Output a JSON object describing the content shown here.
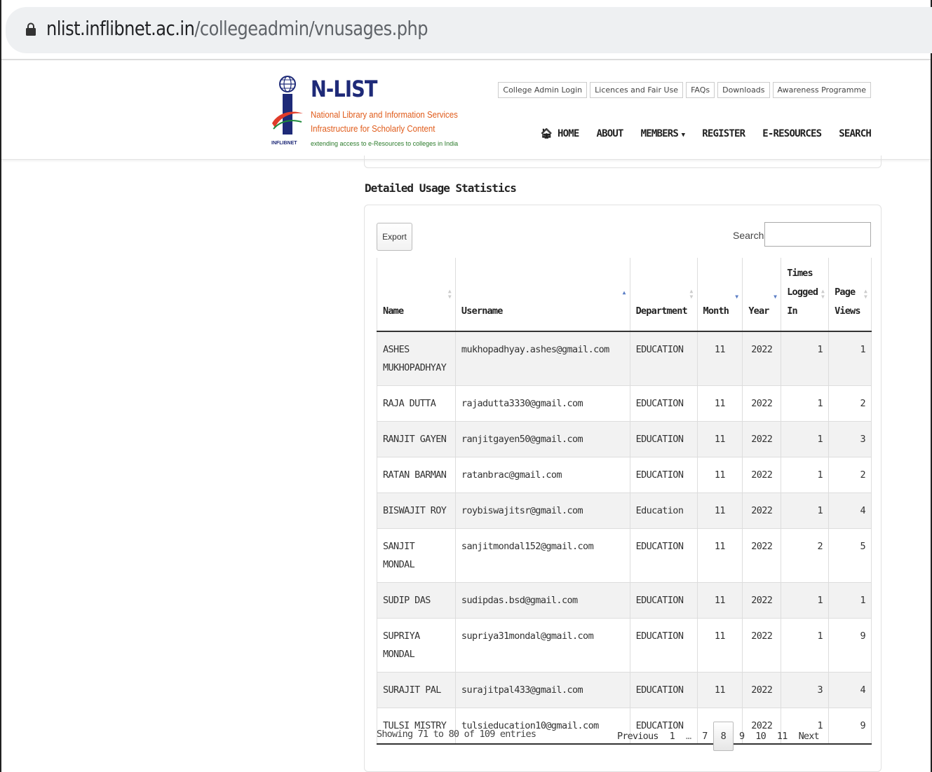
{
  "browser": {
    "url_host": "nlist.inflibnet.ac.in",
    "url_path": "/collegeadmin/vnusages.php"
  },
  "logo": {
    "title": "N-LIST",
    "subtitle1": "National Library and Information Services",
    "subtitle2": "Infrastructure for Scholarly Content",
    "tagline": "extending access to e-Resources to colleges in India",
    "brand": "INFLIBNET"
  },
  "top_links": [
    "College Admin Login",
    "Licences and Fair Use",
    "FAQs",
    "Downloads",
    "Awareness Programme"
  ],
  "nav": {
    "home": "HOME",
    "about": "ABOUT",
    "members": "MEMBERS",
    "register": "REGISTER",
    "eresources": "E-RESOURCES",
    "search": "SEARCH"
  },
  "section_title": "Detailed Usage Statistics",
  "controls": {
    "export_label": "Export",
    "search_label": "Search:",
    "search_value": ""
  },
  "table": {
    "columns": [
      "Name",
      "Username",
      "Department",
      "Month",
      "Year",
      "Times Logged In",
      "Page Views"
    ],
    "rows": [
      [
        "ASHES MUKHOPADHYAY",
        "mukhopadhyay.ashes@gmail.com",
        "EDUCATION",
        "11",
        "2022",
        "1",
        "1"
      ],
      [
        "RAJA DUTTA",
        "rajadutta3330@gmail.com",
        "EDUCATION",
        "11",
        "2022",
        "1",
        "2"
      ],
      [
        "RANJIT GAYEN",
        "ranjitgayen50@gmail.com",
        "EDUCATION",
        "11",
        "2022",
        "1",
        "3"
      ],
      [
        "RATAN BARMAN",
        "ratanbrac@gmail.com",
        "EDUCATION",
        "11",
        "2022",
        "1",
        "2"
      ],
      [
        "BISWAJIT ROY",
        "roybiswajitsr@gmail.com",
        "Education",
        "11",
        "2022",
        "1",
        "4"
      ],
      [
        "SANJIT MONDAL",
        "sanjitmondal152@gmail.com",
        "EDUCATION",
        "11",
        "2022",
        "2",
        "5"
      ],
      [
        "SUDIP DAS",
        "sudipdas.bsd@gmail.com",
        "EDUCATION",
        "11",
        "2022",
        "1",
        "1"
      ],
      [
        "SUPRIYA MONDAL",
        "supriya31mondal@gmail.com",
        "EDUCATION",
        "11",
        "2022",
        "1",
        "9"
      ],
      [
        "SURAJIT PAL",
        "surajitpal433@gmail.com",
        "EDUCATION",
        "11",
        "2022",
        "3",
        "4"
      ],
      [
        "TULSI MISTRY",
        "tulsieducation10@gmail.com",
        "EDUCATION",
        "11",
        "2022",
        "1",
        "9"
      ]
    ]
  },
  "footer": {
    "info": "Showing 71 to 80 of 109 entries",
    "pager": {
      "previous": "Previous",
      "p1": "1",
      "ellipsis": "…",
      "p7": "7",
      "p8": "8",
      "p9": "9",
      "p10": "10",
      "p11": "11",
      "next": "Next"
    }
  }
}
